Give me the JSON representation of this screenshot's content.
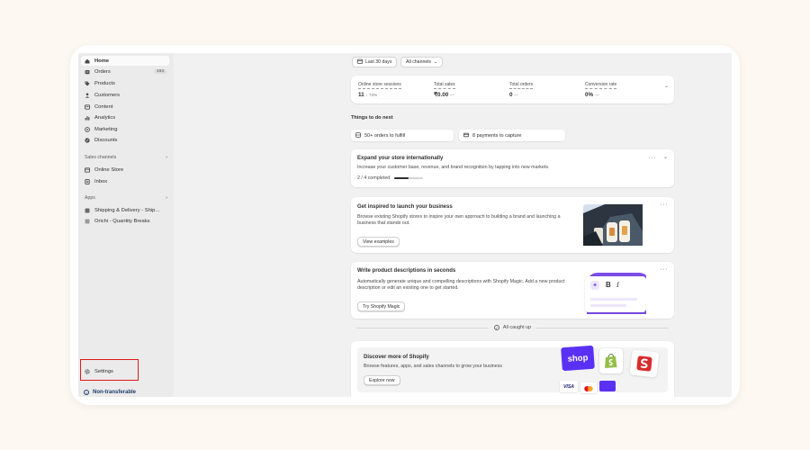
{
  "sidebar": {
    "items": [
      {
        "label": "Home",
        "icon": "home-icon"
      },
      {
        "label": "Orders",
        "icon": "orders-icon",
        "badge": "193"
      },
      {
        "label": "Products",
        "icon": "tag-icon"
      },
      {
        "label": "Customers",
        "icon": "person-icon"
      },
      {
        "label": "Content",
        "icon": "content-icon"
      },
      {
        "label": "Analytics",
        "icon": "bar-chart-icon"
      },
      {
        "label": "Marketing",
        "icon": "target-icon"
      },
      {
        "label": "Discounts",
        "icon": "discount-icon"
      }
    ],
    "sales_channels_label": "Sales channels",
    "sales_channels": [
      {
        "label": "Online Store",
        "icon": "store-icon"
      },
      {
        "label": "Inbox",
        "icon": "inbox-icon"
      }
    ],
    "apps_label": "Apps",
    "apps": [
      {
        "label": "Shipping & Delivery - Ship...",
        "icon": "app-icon"
      },
      {
        "label": "Orichi - Quantity Breaks",
        "icon": "app-icon"
      }
    ],
    "settings_label": "Settings",
    "non_transferable_label": "Non-transferable"
  },
  "filters": {
    "date_range": "Last 30 days",
    "channels": "All channels"
  },
  "metrics": [
    {
      "label": "Online store sessions",
      "value": "11",
      "delta": "↓ 73%"
    },
    {
      "label": "Total sales",
      "value": "₹0.00",
      "delta": "—"
    },
    {
      "label": "Total orders",
      "value": "0",
      "delta": "—"
    },
    {
      "label": "Conversion rate",
      "value": "0%",
      "delta": "—"
    }
  ],
  "things_to_do": {
    "heading": "Things to do next",
    "tasks": [
      {
        "label": "50+ orders to fulfill",
        "icon": "box-icon"
      },
      {
        "label": "8 payments to capture",
        "icon": "payment-icon"
      }
    ]
  },
  "expand_card": {
    "title": "Expand your store internationally",
    "description": "Increase your customer base, revenue, and brand recognition by tapping into new markets.",
    "progress_text": "2 / 4 completed",
    "progress": 0.5
  },
  "inspired_card": {
    "title": "Get inspired to launch your business",
    "description": "Browse existing Shopify stores to inspire your own approach to building a brand and launching a business that stands out.",
    "button": "View examples"
  },
  "descriptions_card": {
    "title": "Write product descriptions in seconds",
    "description": "Automatically generate unique and compelling descriptions with Shopify Magic. Add a new product description or edit an existing one to get started.",
    "button": "Try Shopify Magic",
    "editor_bold": "B",
    "editor_italic": "I"
  },
  "caught_up": "All caught up",
  "discover_card": {
    "title": "Discover more of Shopify",
    "description": "Browse features, apps, and sales channels to grow your business",
    "button": "Explore now",
    "shop_logo": "shop",
    "visa_logo": "VISA"
  },
  "colors": {
    "highlight": "#e01a1a",
    "shop_purple": "#5a31f4",
    "shopify_green": "#95bf47",
    "magic_purple": "#7b4ce6"
  }
}
